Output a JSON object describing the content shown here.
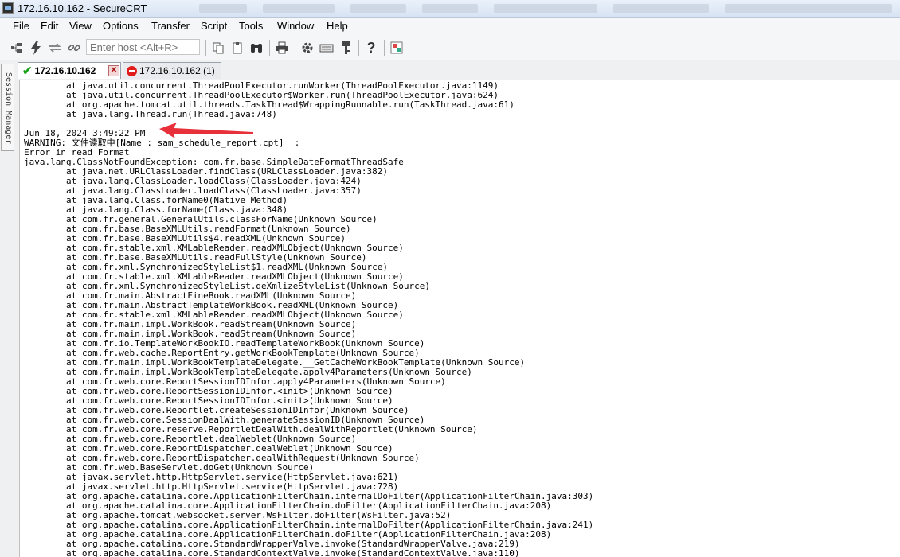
{
  "window": {
    "title": "172.16.10.162 - SecureCRT"
  },
  "menu": [
    "File",
    "Edit",
    "View",
    "Options",
    "Transfer",
    "Script",
    "Tools",
    "Window",
    "Help"
  ],
  "toolbar": {
    "host_placeholder": "Enter host <Alt+R>"
  },
  "session_manager": {
    "label": "Session Manager"
  },
  "tabs": [
    {
      "label": "172.16.10.162",
      "status": "connected"
    },
    {
      "label": "172.16.10.162 (1)",
      "status": "disconnected"
    }
  ],
  "terminal": {
    "lines": [
      "        at java.util.concurrent.ThreadPoolExecutor.runWorker(ThreadPoolExecutor.java:1149)",
      "        at java.util.concurrent.ThreadPoolExecutor$Worker.run(ThreadPoolExecutor.java:624)",
      "        at org.apache.tomcat.util.threads.TaskThread$WrappingRunnable.run(TaskThread.java:61)",
      "        at java.lang.Thread.run(Thread.java:748)",
      "",
      "Jun 18, 2024 3:49:22 PM",
      "WARNING: 文件读取中[Name : sam_schedule_report.cpt]  :",
      "Error in read Format",
      "java.lang.ClassNotFoundException: com.fr.base.SimpleDateFormatThreadSafe",
      "        at java.net.URLClassLoader.findClass(URLClassLoader.java:382)",
      "        at java.lang.ClassLoader.loadClass(ClassLoader.java:424)",
      "        at java.lang.ClassLoader.loadClass(ClassLoader.java:357)",
      "        at java.lang.Class.forName0(Native Method)",
      "        at java.lang.Class.forName(Class.java:348)",
      "        at com.fr.general.GeneralUtils.classForName(Unknown Source)",
      "        at com.fr.base.BaseXMLUtils.readFormat(Unknown Source)",
      "        at com.fr.base.BaseXMLUtils$4.readXML(Unknown Source)",
      "        at com.fr.stable.xml.XMLableReader.readXMLObject(Unknown Source)",
      "        at com.fr.base.BaseXMLUtils.readFullStyle(Unknown Source)",
      "        at com.fr.xml.SynchronizedStyleList$1.readXML(Unknown Source)",
      "        at com.fr.stable.xml.XMLableReader.readXMLObject(Unknown Source)",
      "        at com.fr.xml.SynchronizedStyleList.deXmlizeStyleList(Unknown Source)",
      "        at com.fr.main.AbstractFineBook.readXML(Unknown Source)",
      "        at com.fr.main.AbstractTemplateWorkBook.readXML(Unknown Source)",
      "        at com.fr.stable.xml.XMLableReader.readXMLObject(Unknown Source)",
      "        at com.fr.main.impl.WorkBook.readStream(Unknown Source)",
      "        at com.fr.main.impl.WorkBook.readStream(Unknown Source)",
      "        at com.fr.io.TemplateWorkBookIO.readTemplateWorkBook(Unknown Source)",
      "        at com.fr.web.cache.ReportEntry.getWorkBookTemplate(Unknown Source)",
      "        at com.fr.main.impl.WorkBookTemplateDelegate.__GetCacheWorkBookTemplate(Unknown Source)",
      "        at com.fr.main.impl.WorkBookTemplateDelegate.apply4Parameters(Unknown Source)",
      "        at com.fr.web.core.ReportSessionIDInfor.apply4Parameters(Unknown Source)",
      "        at com.fr.web.core.ReportSessionIDInfor.<init>(Unknown Source)",
      "        at com.fr.web.core.ReportSessionIDInfor.<init>(Unknown Source)",
      "        at com.fr.web.core.Reportlet.createSessionIDInfor(Unknown Source)",
      "        at com.fr.web.core.SessionDealWith.generateSessionID(Unknown Source)",
      "        at com.fr.web.core.reserve.ReportletDealWith.dealWithReportlet(Unknown Source)",
      "        at com.fr.web.core.Reportlet.dealWeblet(Unknown Source)",
      "        at com.fr.web.core.ReportDispatcher.dealWeblet(Unknown Source)",
      "        at com.fr.web.core.ReportDispatcher.dealWithRequest(Unknown Source)",
      "        at com.fr.web.BaseServlet.doGet(Unknown Source)",
      "        at javax.servlet.http.HttpServlet.service(HttpServlet.java:621)",
      "        at javax.servlet.http.HttpServlet.service(HttpServlet.java:728)",
      "        at org.apache.catalina.core.ApplicationFilterChain.internalDoFilter(ApplicationFilterChain.java:303)",
      "        at org.apache.catalina.core.ApplicationFilterChain.doFilter(ApplicationFilterChain.java:208)",
      "        at org.apache.tomcat.websocket.server.WsFilter.doFilter(WsFilter.java:52)",
      "        at org.apache.catalina.core.ApplicationFilterChain.internalDoFilter(ApplicationFilterChain.java:241)",
      "        at org.apache.catalina.core.ApplicationFilterChain.doFilter(ApplicationFilterChain.java:208)",
      "        at org.apache.catalina.core.StandardWrapperValve.invoke(StandardWrapperValve.java:219)",
      "        at org.apache.catalina.core.StandardContextValve.invoke(StandardContextValve.java:110)"
    ]
  },
  "colors": {
    "annotation_arrow": "#e8303a",
    "connected": "#1aa31a",
    "disconnected": "#e21b1b"
  }
}
